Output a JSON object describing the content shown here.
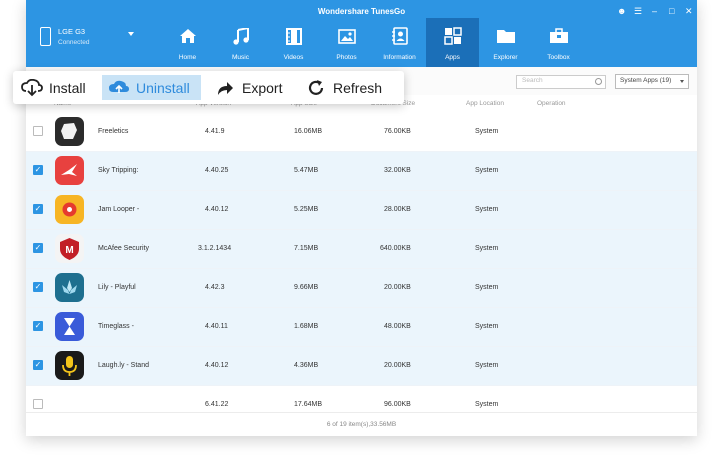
{
  "window": {
    "title": "Wondershare TunesGo"
  },
  "device": {
    "name": "LGE G3",
    "status": "Connected"
  },
  "nav": [
    {
      "label": "Home",
      "icon": "home-icon"
    },
    {
      "label": "Music",
      "icon": "music-icon"
    },
    {
      "label": "Videos",
      "icon": "video-icon"
    },
    {
      "label": "Photos",
      "icon": "photo-icon"
    },
    {
      "label": "Information",
      "icon": "contacts-icon"
    },
    {
      "label": "Apps",
      "icon": "apps-icon",
      "active": true
    },
    {
      "label": "Explorer",
      "icon": "folder-icon"
    },
    {
      "label": "Toolbox",
      "icon": "toolbox-icon"
    }
  ],
  "toolbar": {
    "install_label": "Install",
    "uninstall_label": "Uninstall",
    "export_label": "Export",
    "refresh_label": "Refresh"
  },
  "search": {
    "placeholder": "Search"
  },
  "filter": {
    "selected": "System Apps (19)"
  },
  "columns": {
    "name": "Name",
    "app_version": "App Version",
    "app_size": "App Size",
    "document_size": "Document Size",
    "app_location": "App Location",
    "operation": "Operation"
  },
  "rows": [
    {
      "name": "Freeletics",
      "version": "4.41.9",
      "size": "16.06MB",
      "doc_size": "76.00KB",
      "location": "System",
      "checked": false,
      "icon_bg": "#2b2b2b"
    },
    {
      "name": "Sky Tripping:",
      "version": "4.40.25",
      "size": "5.47MB",
      "doc_size": "32.00KB",
      "location": "System",
      "checked": true,
      "icon_bg": "#e8413f"
    },
    {
      "name": "Jam Looper -",
      "version": "4.40.12",
      "size": "5.25MB",
      "doc_size": "28.00KB",
      "location": "System",
      "checked": true,
      "icon_bg": "#f7b524"
    },
    {
      "name": "McAfee Security",
      "version": "3.1.2.1434",
      "size": "7.15MB",
      "doc_size": "640.00KB",
      "location": "System",
      "checked": true,
      "icon_bg": "#4a4a4a"
    },
    {
      "name": "Lily - Playful",
      "version": "4.42.3",
      "size": "9.66MB",
      "doc_size": "20.00KB",
      "location": "System",
      "checked": true,
      "icon_bg": "#1e6f8f"
    },
    {
      "name": "Timeglass -",
      "version": "4.40.11",
      "size": "1.68MB",
      "doc_size": "48.00KB",
      "location": "System",
      "checked": true,
      "icon_bg": "#3a5bd9"
    },
    {
      "name": "Laugh.ly - Stand",
      "version": "4.40.12",
      "size": "4.36MB",
      "doc_size": "20.00KB",
      "location": "System",
      "checked": true,
      "icon_bg": "#1a1a1a"
    },
    {
      "name": "",
      "version": "6.41.22",
      "size": "17.64MB",
      "doc_size": "96.00KB",
      "location": "System",
      "checked": false,
      "icon_bg": ""
    }
  ],
  "status_bar": "6 of 19 item(s),33.56MB"
}
